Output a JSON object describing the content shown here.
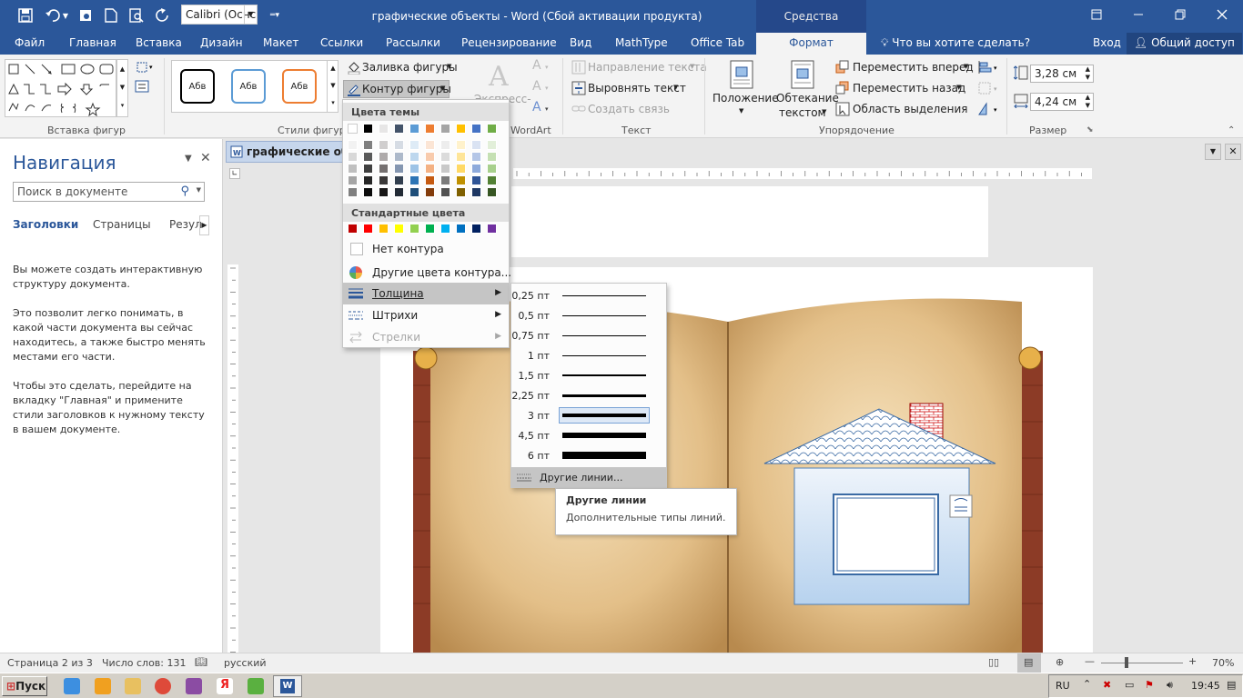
{
  "window": {
    "doc_title": "графические объекты - Word (Сбой активации продукта)",
    "context_title": "Средства рисования",
    "font_name": "Calibri (Оснс"
  },
  "tabs": [
    "Файл",
    "Главная",
    "Вставка",
    "Дизайн",
    "Макет",
    "Ссылки",
    "Рассылки",
    "Рецензирование",
    "Вид",
    "MathType",
    "Office Tab",
    "Формат"
  ],
  "tell_me": "Что вы хотите сделать?",
  "signin": "Вход",
  "share": "Общий доступ",
  "ribbon": {
    "group_insert_shapes": "Вставка фигур",
    "group_shape_styles": "Стили фигур",
    "style_sample": "Абв",
    "fill": "Заливка фигуры",
    "outline": "Контур фигуры",
    "express": "Экспресс-",
    "group_wordart": "WordArt",
    "text_direction": "Направление текста",
    "align_text": "Выровнять текст",
    "create_link": "Создать связь",
    "group_text": "Текст",
    "position": "Положение",
    "wrap_text": "Обтекание",
    "wrap_text2": "текстом",
    "bring_forward": "Переместить вперед",
    "send_backward": "Переместить назад",
    "selection_pane": "Область выделения",
    "group_arrange": "Упорядочение",
    "height": "3,28 см",
    "width": "4,24 см",
    "group_size": "Размер"
  },
  "nav": {
    "title": "Навигация",
    "search_placeholder": "Поиск в документе",
    "tab_headings": "Заголовки",
    "tab_pages": "Страницы",
    "tab_results": "Резул",
    "p1": "Вы можете создать интерактивную структуру документа.",
    "p2": "Это позволит легко понимать, в какой части документа вы сейчас находитесь, а также быстро менять местами его части.",
    "p3": "Чтобы это сделать, перейдите на вкладку \"Главная\" и примените стили заголовков к нужному тексту в вашем документе."
  },
  "doc_tab": "графические объекты",
  "color_menu": {
    "theme_colors": "Цвета темы",
    "standard_colors": "Стандартные цвета",
    "no_outline": "Нет контура",
    "more_colors": "Другие цвета контура...",
    "weight": "Толщина",
    "dashes": "Штрихи",
    "arrows": "Стрелки",
    "theme_top": [
      "#ffffff",
      "#000000",
      "#e7e6e6",
      "#44546a",
      "#5b9bd5",
      "#ed7d31",
      "#a5a5a5",
      "#ffc000",
      "#4472c4",
      "#70ad47"
    ],
    "theme_shades": [
      [
        "#f2f2f2",
        "#7f7f7f",
        "#d0cece",
        "#d6dce4",
        "#deebf6",
        "#fbe5d5",
        "#ededed",
        "#fff2cc",
        "#dae3f3",
        "#e2efd9"
      ],
      [
        "#d8d8d8",
        "#595959",
        "#aeaaaa",
        "#adb9ca",
        "#bdd7ee",
        "#f8cbad",
        "#dbdbdb",
        "#fee599",
        "#b4c6e7",
        "#c5e0b3"
      ],
      [
        "#bfbfbf",
        "#3f3f3f",
        "#757070",
        "#8496b0",
        "#9dc3e6",
        "#f4b183",
        "#c9c9c9",
        "#ffd965",
        "#8eaadb",
        "#a8d08d"
      ],
      [
        "#a5a5a5",
        "#262626",
        "#3a3838",
        "#323f4f",
        "#2e75b5",
        "#c55a11",
        "#7b7b7b",
        "#bf9000",
        "#2f5496",
        "#538135"
      ],
      [
        "#7f7f7f",
        "#0c0c0c",
        "#171616",
        "#222a35",
        "#1e4e79",
        "#833c0b",
        "#525252",
        "#7f6000",
        "#1f3864",
        "#375623"
      ]
    ],
    "standard": [
      "#c00000",
      "#ff0000",
      "#ffc000",
      "#ffff00",
      "#92d050",
      "#00b050",
      "#00b0f0",
      "#0070c0",
      "#002060",
      "#7030a0"
    ]
  },
  "weight_menu": {
    "items": [
      {
        "label": "0,25 пт",
        "w": 0.25
      },
      {
        "label": "0,5 пт",
        "w": 0.5
      },
      {
        "label": "0,75 пт",
        "w": 0.75
      },
      {
        "label": "1 пт",
        "w": 1
      },
      {
        "label": "1,5 пт",
        "w": 1.5
      },
      {
        "label": "2,25 пт",
        "w": 2.25
      },
      {
        "label": "3 пт",
        "w": 3
      },
      {
        "label": "4,5 пт",
        "w": 4.5
      },
      {
        "label": "6 пт",
        "w": 6
      }
    ],
    "more_lines": "Другие линии..."
  },
  "tooltip": {
    "title": "Другие линии",
    "body": "Дополнительные типы линий."
  },
  "status": {
    "page": "Страница 2 из 3",
    "words": "Число слов: 131",
    "lang": "русский",
    "zoom": "70%"
  },
  "taskbar": {
    "start": "Пуск",
    "lang": "RU",
    "time": "19:45"
  }
}
